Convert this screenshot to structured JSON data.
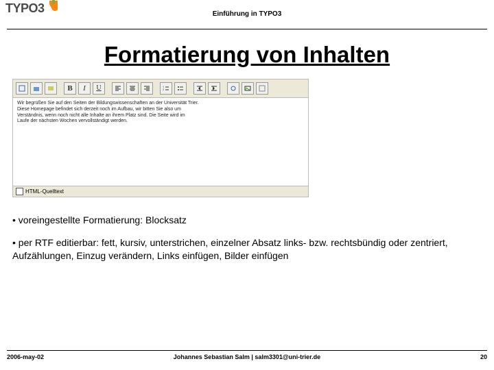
{
  "header": {
    "title": "Einführung in TYPO3",
    "logo_text": "TYPO3"
  },
  "slide": {
    "title": "Formatierung von Inhalten"
  },
  "editor": {
    "toolbar": {
      "btn_bold": "B",
      "btn_italic": "I",
      "btn_underline": "U"
    },
    "text_line1": "Wir begrüßen Sie auf den Seiten der Bildungswissenschaften an der Universität Trier.",
    "text_line2": "Diese Homepage befindet sich derzeit noch im Aufbau, wir bitten Sie also um",
    "text_line3": "Verständnis, wenn noch nicht alle Inhalte an ihrem Platz sind. Die Seite wird im",
    "text_line4": "Laufe der nächsten Wochen vervollständigt werden.",
    "html_quelltext_label": "HTML-Quelltext"
  },
  "bullets": {
    "b1": "• voreingestellte Formatierung: Blocksatz",
    "b2": "• per RTF editierbar: fett, kursiv, unterstrichen, einzelner Absatz links- bzw. rechtsbündig oder zentriert, Aufzählungen, Einzug verändern, Links einfügen, Bilder einfügen"
  },
  "footer": {
    "date": "2006-may-02",
    "author": "Johannes Sebastian Salm | salm3301@uni-trier.de",
    "page": "20"
  }
}
